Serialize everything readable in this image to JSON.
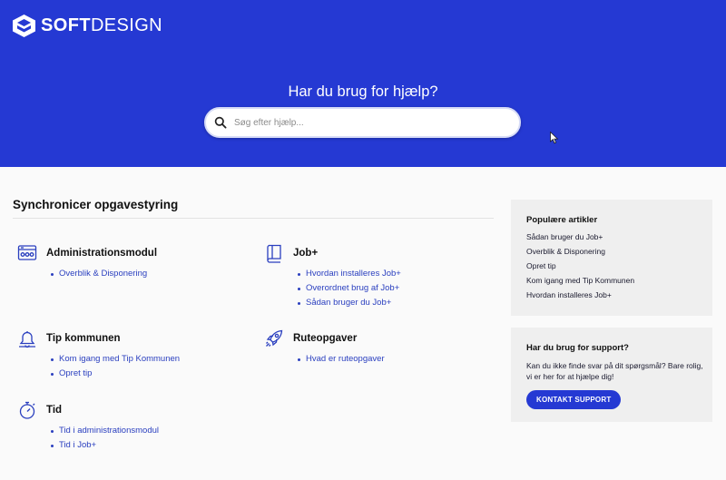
{
  "brand": {
    "logo_bold": "SOFT",
    "logo_light": "DESIGN",
    "icon": "softdesign-logo-icon"
  },
  "hero": {
    "title": "Har du brug for hjælp?",
    "search_placeholder": "Søg efter hjælp...",
    "background": "#2539d3"
  },
  "main": {
    "section_title": "Synchronicer opgavestyring",
    "categories": [
      {
        "name": "Administrationsmodul",
        "icon": "dashboard-icon",
        "links": [
          "Overblik & Disponering"
        ]
      },
      {
        "name": "Job+",
        "icon": "book-icon",
        "links": [
          "Hvordan installeres Job+",
          "Overordnet brug af Job+",
          "Sådan bruger du Job+"
        ]
      },
      {
        "name": "Tip kommunen",
        "icon": "bell-icon",
        "links": [
          "Kom igang med Tip Kommunen",
          "Opret tip"
        ]
      },
      {
        "name": "Ruteopgaver",
        "icon": "rocket-icon",
        "links": [
          "Hvad er ruteopgaver"
        ]
      },
      {
        "name": "Tid",
        "icon": "stopwatch-icon",
        "links": [
          "Tid i administrationsmodul",
          "Tid i Job+"
        ]
      }
    ]
  },
  "sidebar": {
    "popular": {
      "title": "Populære artikler",
      "items": [
        "Sådan bruger du Job+",
        "Overblik & Disponering",
        "Opret tip",
        "Kom igang med Tip Kommunen",
        "Hvordan installeres Job+"
      ]
    },
    "support": {
      "title": "Har du brug for support?",
      "text": "Kan du ikke finde svar på dit spørgsmål? Bare rolig, vi er her for at hjælpe dig!",
      "button": "KONTAKT SUPPORT"
    }
  },
  "colors": {
    "accent": "#2539d3",
    "link": "#2a3fbf",
    "panel": "#efefef"
  }
}
